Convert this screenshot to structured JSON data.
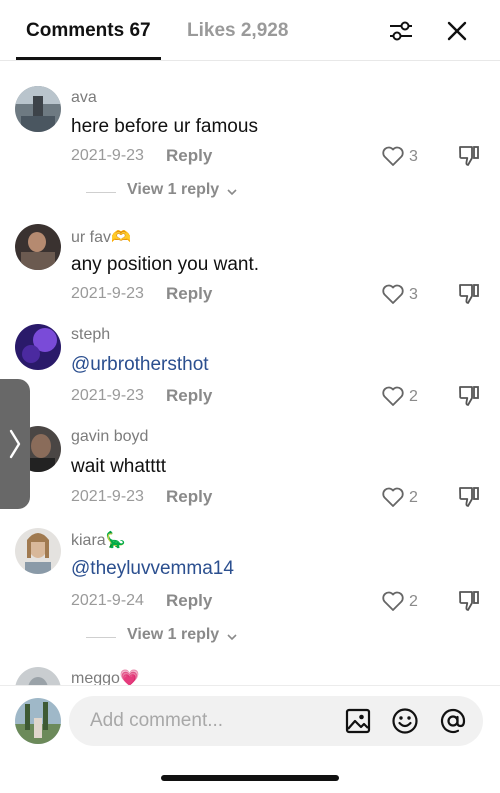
{
  "tabs": {
    "comments_label": "Comments 67",
    "likes_label": "Likes 2,928"
  },
  "icons": {
    "filter": "sliders-icon",
    "close": "close-icon",
    "heart": "heart-outline-icon",
    "dislike": "thumbs-down-icon",
    "image": "image-icon",
    "emoji": "smiley-icon",
    "mention": "at-sign-icon"
  },
  "comments": [
    {
      "username": "ava",
      "text": "here before ur famous",
      "date": "2021-9-23",
      "reply_label": "Reply",
      "likes": "3",
      "view_replies": "View 1 reply"
    },
    {
      "username": "ur fav🫶",
      "text": "any position you want.",
      "date": "2021-9-23",
      "reply_label": "Reply",
      "likes": "3"
    },
    {
      "username": "steph",
      "text": "@urbrothersthot",
      "date": "2021-9-23",
      "reply_label": "Reply",
      "likes": "2"
    },
    {
      "username": "gavin boyd",
      "text": "wait whatttt",
      "date": "2021-9-23",
      "reply_label": "Reply",
      "likes": "2"
    },
    {
      "username": "kiara🦕",
      "text": "@theyluvvemma14",
      "date": "2021-9-24",
      "reply_label": "Reply",
      "likes": "2",
      "view_replies": "View 1 reply"
    },
    {
      "username": "meggo💗"
    }
  ],
  "composer": {
    "placeholder": "Add comment..."
  },
  "colors": {
    "mention": "#2b4f8f",
    "secondary_text": "#9a9a9a"
  }
}
